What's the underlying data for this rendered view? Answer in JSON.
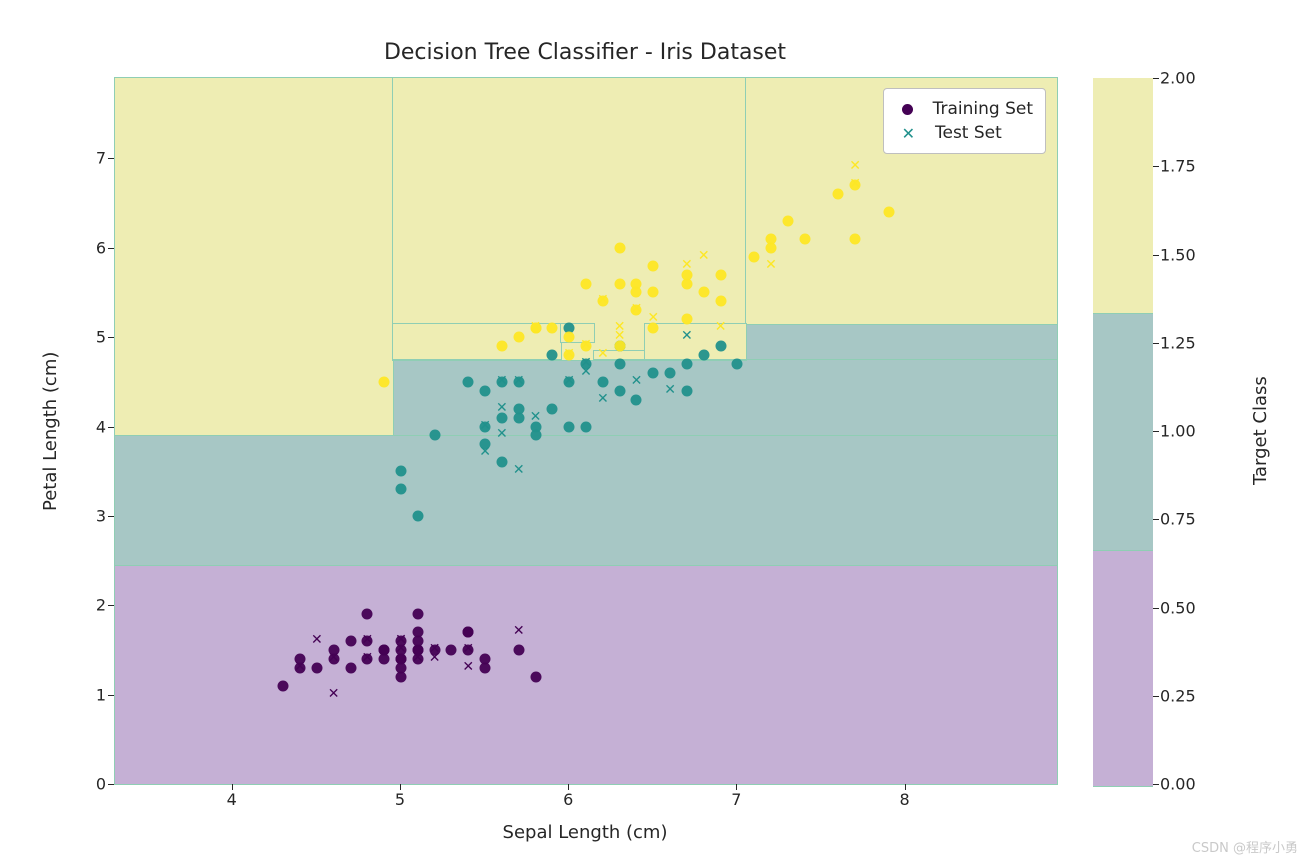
{
  "watermark": "CSDN @程序小勇",
  "chart_data": {
    "type": "scatter",
    "title": "Decision Tree Classifier - Iris Dataset",
    "xlabel": "Sepal Length (cm)",
    "ylabel": "Petal Length (cm)",
    "colorbar_label": "Target Class",
    "xrange": [
      3.3,
      8.9
    ],
    "yrange": [
      0.0,
      7.9
    ],
    "xticks": [
      4,
      5,
      6,
      7,
      8
    ],
    "yticks": [
      0,
      1,
      2,
      3,
      4,
      5,
      6,
      7
    ],
    "legend": {
      "train": "Training Set",
      "test": "Test Set"
    },
    "region_colors": {
      "class0": "#c5b0d5",
      "class1": "#a7c7c5",
      "class2": "#eeedb3",
      "border": "#8fceb4"
    },
    "decision_regions": [
      {
        "class": 0,
        "x": [
          3.3,
          8.9
        ],
        "y": [
          0.0,
          2.45
        ]
      },
      {
        "class": 1,
        "x": [
          3.3,
          8.9
        ],
        "y": [
          2.45,
          3.9
        ]
      },
      {
        "class": 1,
        "x": [
          4.95,
          8.9
        ],
        "y": [
          3.9,
          4.75
        ]
      },
      {
        "class": 1,
        "x": [
          7.05,
          8.9
        ],
        "y": [
          4.75,
          5.15
        ]
      },
      {
        "class": 1,
        "x": [
          5.95,
          6.15
        ],
        "y": [
          4.75,
          4.95
        ]
      },
      {
        "class": 1,
        "x": [
          6.15,
          6.45
        ],
        "y": [
          4.85,
          5.15
        ]
      },
      {
        "class": 2,
        "x": [
          3.3,
          4.95
        ],
        "y": [
          3.9,
          7.9
        ]
      },
      {
        "class": 2,
        "x": [
          4.95,
          7.05
        ],
        "y": [
          4.75,
          7.9
        ]
      },
      {
        "class": 2,
        "x": [
          7.05,
          8.9
        ],
        "y": [
          5.15,
          7.9
        ]
      },
      {
        "class": 2,
        "x": [
          4.95,
          5.95
        ],
        "y": [
          4.75,
          5.15
        ]
      },
      {
        "class": 2,
        "x": [
          5.95,
          6.15
        ],
        "y": [
          4.95,
          5.15
        ]
      },
      {
        "class": 2,
        "x": [
          6.15,
          6.45
        ],
        "y": [
          4.75,
          4.85
        ]
      },
      {
        "class": 2,
        "x": [
          6.45,
          7.05
        ],
        "y": [
          4.75,
          5.15
        ]
      }
    ],
    "colorbar_ticks": [
      0.0,
      0.25,
      0.5,
      0.75,
      1.0,
      1.25,
      1.5,
      1.75,
      2.0
    ],
    "class_colors": {
      "0": "#440154",
      "1": "#21918c",
      "2": "#fde725"
    },
    "series": [
      {
        "name": "Training Set",
        "marker": "circle",
        "points": [
          {
            "x": 5.1,
            "y": 1.4,
            "c": 0
          },
          {
            "x": 4.9,
            "y": 1.4,
            "c": 0
          },
          {
            "x": 4.7,
            "y": 1.3,
            "c": 0
          },
          {
            "x": 4.6,
            "y": 1.5,
            "c": 0
          },
          {
            "x": 5.0,
            "y": 1.4,
            "c": 0
          },
          {
            "x": 5.4,
            "y": 1.7,
            "c": 0
          },
          {
            "x": 4.6,
            "y": 1.4,
            "c": 0
          },
          {
            "x": 5.0,
            "y": 1.5,
            "c": 0
          },
          {
            "x": 4.4,
            "y": 1.4,
            "c": 0
          },
          {
            "x": 4.9,
            "y": 1.5,
            "c": 0
          },
          {
            "x": 5.4,
            "y": 1.5,
            "c": 0
          },
          {
            "x": 4.8,
            "y": 1.6,
            "c": 0
          },
          {
            "x": 4.3,
            "y": 1.1,
            "c": 0
          },
          {
            "x": 5.8,
            "y": 1.2,
            "c": 0
          },
          {
            "x": 5.1,
            "y": 1.5,
            "c": 0
          },
          {
            "x": 5.7,
            "y": 1.5,
            "c": 0
          },
          {
            "x": 5.1,
            "y": 1.7,
            "c": 0
          },
          {
            "x": 5.4,
            "y": 1.7,
            "c": 0
          },
          {
            "x": 5.1,
            "y": 1.5,
            "c": 0
          },
          {
            "x": 4.8,
            "y": 1.9,
            "c": 0
          },
          {
            "x": 5.0,
            "y": 1.6,
            "c": 0
          },
          {
            "x": 5.2,
            "y": 1.5,
            "c": 0
          },
          {
            "x": 4.7,
            "y": 1.6,
            "c": 0
          },
          {
            "x": 5.5,
            "y": 1.4,
            "c": 0
          },
          {
            "x": 4.9,
            "y": 1.5,
            "c": 0
          },
          {
            "x": 5.0,
            "y": 1.2,
            "c": 0
          },
          {
            "x": 5.5,
            "y": 1.3,
            "c": 0
          },
          {
            "x": 4.4,
            "y": 1.3,
            "c": 0
          },
          {
            "x": 5.0,
            "y": 1.3,
            "c": 0
          },
          {
            "x": 4.5,
            "y": 1.3,
            "c": 0
          },
          {
            "x": 5.1,
            "y": 1.9,
            "c": 0
          },
          {
            "x": 4.8,
            "y": 1.4,
            "c": 0
          },
          {
            "x": 5.1,
            "y": 1.6,
            "c": 0
          },
          {
            "x": 5.3,
            "y": 1.5,
            "c": 0
          },
          {
            "x": 5.0,
            "y": 1.4,
            "c": 0
          },
          {
            "x": 5.5,
            "y": 4.0,
            "c": 1
          },
          {
            "x": 6.5,
            "y": 4.6,
            "c": 1
          },
          {
            "x": 5.7,
            "y": 4.5,
            "c": 1
          },
          {
            "x": 6.3,
            "y": 4.7,
            "c": 1
          },
          {
            "x": 6.6,
            "y": 4.6,
            "c": 1
          },
          {
            "x": 5.2,
            "y": 3.9,
            "c": 1
          },
          {
            "x": 5.9,
            "y": 4.2,
            "c": 1
          },
          {
            "x": 6.0,
            "y": 4.0,
            "c": 1
          },
          {
            "x": 5.6,
            "y": 3.6,
            "c": 1
          },
          {
            "x": 6.7,
            "y": 4.4,
            "c": 1
          },
          {
            "x": 5.6,
            "y": 4.5,
            "c": 1
          },
          {
            "x": 6.2,
            "y": 4.5,
            "c": 1
          },
          {
            "x": 5.9,
            "y": 4.8,
            "c": 1
          },
          {
            "x": 6.1,
            "y": 4.0,
            "c": 1
          },
          {
            "x": 6.3,
            "y": 4.4,
            "c": 1
          },
          {
            "x": 6.1,
            "y": 4.7,
            "c": 1
          },
          {
            "x": 6.4,
            "y": 4.3,
            "c": 1
          },
          {
            "x": 6.8,
            "y": 4.8,
            "c": 1
          },
          {
            "x": 5.7,
            "y": 4.2,
            "c": 1
          },
          {
            "x": 5.5,
            "y": 3.8,
            "c": 1
          },
          {
            "x": 5.4,
            "y": 4.5,
            "c": 1
          },
          {
            "x": 6.0,
            "y": 4.5,
            "c": 1
          },
          {
            "x": 6.3,
            "y": 4.9,
            "c": 1
          },
          {
            "x": 5.5,
            "y": 4.4,
            "c": 1
          },
          {
            "x": 5.6,
            "y": 4.1,
            "c": 1
          },
          {
            "x": 5.0,
            "y": 3.3,
            "c": 1
          },
          {
            "x": 5.0,
            "y": 3.5,
            "c": 1
          },
          {
            "x": 5.8,
            "y": 4.0,
            "c": 1
          },
          {
            "x": 5.7,
            "y": 4.1,
            "c": 1
          },
          {
            "x": 6.9,
            "y": 4.9,
            "c": 1
          },
          {
            "x": 6.7,
            "y": 4.7,
            "c": 1
          },
          {
            "x": 5.1,
            "y": 3.0,
            "c": 1
          },
          {
            "x": 5.8,
            "y": 3.9,
            "c": 1
          },
          {
            "x": 6.0,
            "y": 5.1,
            "c": 1
          },
          {
            "x": 7.0,
            "y": 4.7,
            "c": 1
          },
          {
            "x": 6.3,
            "y": 6.0,
            "c": 2
          },
          {
            "x": 5.8,
            "y": 5.1,
            "c": 2
          },
          {
            "x": 7.1,
            "y": 5.9,
            "c": 2
          },
          {
            "x": 6.5,
            "y": 5.8,
            "c": 2
          },
          {
            "x": 4.9,
            "y": 4.5,
            "c": 2
          },
          {
            "x": 7.3,
            "y": 6.3,
            "c": 2
          },
          {
            "x": 7.2,
            "y": 6.1,
            "c": 2
          },
          {
            "x": 6.5,
            "y": 5.1,
            "c": 2
          },
          {
            "x": 6.4,
            "y": 5.3,
            "c": 2
          },
          {
            "x": 5.7,
            "y": 5.0,
            "c": 2
          },
          {
            "x": 7.7,
            "y": 6.7,
            "c": 2
          },
          {
            "x": 6.0,
            "y": 5.0,
            "c": 2
          },
          {
            "x": 6.9,
            "y": 5.7,
            "c": 2
          },
          {
            "x": 5.6,
            "y": 4.9,
            "c": 2
          },
          {
            "x": 6.3,
            "y": 4.9,
            "c": 2
          },
          {
            "x": 6.7,
            "y": 5.7,
            "c": 2
          },
          {
            "x": 7.2,
            "y": 6.0,
            "c": 2
          },
          {
            "x": 6.1,
            "y": 4.9,
            "c": 2
          },
          {
            "x": 7.4,
            "y": 6.1,
            "c": 2
          },
          {
            "x": 6.4,
            "y": 5.6,
            "c": 2
          },
          {
            "x": 6.1,
            "y": 5.6,
            "c": 2
          },
          {
            "x": 7.7,
            "y": 6.1,
            "c": 2
          },
          {
            "x": 6.3,
            "y": 5.6,
            "c": 2
          },
          {
            "x": 6.4,
            "y": 5.5,
            "c": 2
          },
          {
            "x": 6.9,
            "y": 5.4,
            "c": 2
          },
          {
            "x": 6.7,
            "y": 5.2,
            "c": 2
          },
          {
            "x": 5.8,
            "y": 5.1,
            "c": 2
          },
          {
            "x": 6.7,
            "y": 5.6,
            "c": 2
          },
          {
            "x": 6.0,
            "y": 4.8,
            "c": 2
          },
          {
            "x": 6.5,
            "y": 5.5,
            "c": 2
          },
          {
            "x": 7.6,
            "y": 6.6,
            "c": 2
          },
          {
            "x": 7.9,
            "y": 6.4,
            "c": 2
          },
          {
            "x": 6.8,
            "y": 5.5,
            "c": 2
          },
          {
            "x": 6.2,
            "y": 5.4,
            "c": 2
          },
          {
            "x": 5.9,
            "y": 5.1,
            "c": 2
          }
        ]
      },
      {
        "name": "Test Set",
        "marker": "x",
        "points": [
          {
            "x": 4.8,
            "y": 1.6,
            "c": 0
          },
          {
            "x": 5.2,
            "y": 1.4,
            "c": 0
          },
          {
            "x": 5.4,
            "y": 1.3,
            "c": 0
          },
          {
            "x": 5.0,
            "y": 1.6,
            "c": 0
          },
          {
            "x": 4.6,
            "y": 1.0,
            "c": 0
          },
          {
            "x": 5.1,
            "y": 1.4,
            "c": 0
          },
          {
            "x": 5.0,
            "y": 1.6,
            "c": 0
          },
          {
            "x": 5.2,
            "y": 1.5,
            "c": 0
          },
          {
            "x": 4.8,
            "y": 1.4,
            "c": 0
          },
          {
            "x": 5.7,
            "y": 1.7,
            "c": 0
          },
          {
            "x": 5.4,
            "y": 1.5,
            "c": 0
          },
          {
            "x": 4.4,
            "y": 1.3,
            "c": 0
          },
          {
            "x": 4.6,
            "y": 1.4,
            "c": 0
          },
          {
            "x": 4.5,
            "y": 1.6,
            "c": 0
          },
          {
            "x": 5.0,
            "y": 1.5,
            "c": 0
          },
          {
            "x": 5.6,
            "y": 3.9,
            "c": 1
          },
          {
            "x": 6.1,
            "y": 4.7,
            "c": 1
          },
          {
            "x": 5.8,
            "y": 4.1,
            "c": 1
          },
          {
            "x": 6.6,
            "y": 4.4,
            "c": 1
          },
          {
            "x": 5.5,
            "y": 4.0,
            "c": 1
          },
          {
            "x": 6.4,
            "y": 4.5,
            "c": 1
          },
          {
            "x": 6.1,
            "y": 4.6,
            "c": 1
          },
          {
            "x": 6.0,
            "y": 4.5,
            "c": 1
          },
          {
            "x": 6.7,
            "y": 5.0,
            "c": 1
          },
          {
            "x": 5.6,
            "y": 4.2,
            "c": 1
          },
          {
            "x": 5.7,
            "y": 3.5,
            "c": 1
          },
          {
            "x": 6.2,
            "y": 4.3,
            "c": 1
          },
          {
            "x": 5.5,
            "y": 3.7,
            "c": 1
          },
          {
            "x": 5.7,
            "y": 4.5,
            "c": 1
          },
          {
            "x": 5.6,
            "y": 4.5,
            "c": 1
          },
          {
            "x": 6.8,
            "y": 5.9,
            "c": 2
          },
          {
            "x": 7.7,
            "y": 6.9,
            "c": 2
          },
          {
            "x": 6.7,
            "y": 5.8,
            "c": 2
          },
          {
            "x": 5.8,
            "y": 5.1,
            "c": 2
          },
          {
            "x": 7.2,
            "y": 5.8,
            "c": 2
          },
          {
            "x": 6.3,
            "y": 5.0,
            "c": 2
          },
          {
            "x": 6.9,
            "y": 5.1,
            "c": 2
          },
          {
            "x": 6.4,
            "y": 5.3,
            "c": 2
          },
          {
            "x": 6.5,
            "y": 5.2,
            "c": 2
          },
          {
            "x": 6.2,
            "y": 4.8,
            "c": 2
          },
          {
            "x": 7.7,
            "y": 6.7,
            "c": 2
          },
          {
            "x": 6.0,
            "y": 4.8,
            "c": 2
          },
          {
            "x": 6.3,
            "y": 5.1,
            "c": 2
          },
          {
            "x": 6.2,
            "y": 5.4,
            "c": 2
          },
          {
            "x": 6.1,
            "y": 4.9,
            "c": 2
          }
        ]
      }
    ]
  }
}
